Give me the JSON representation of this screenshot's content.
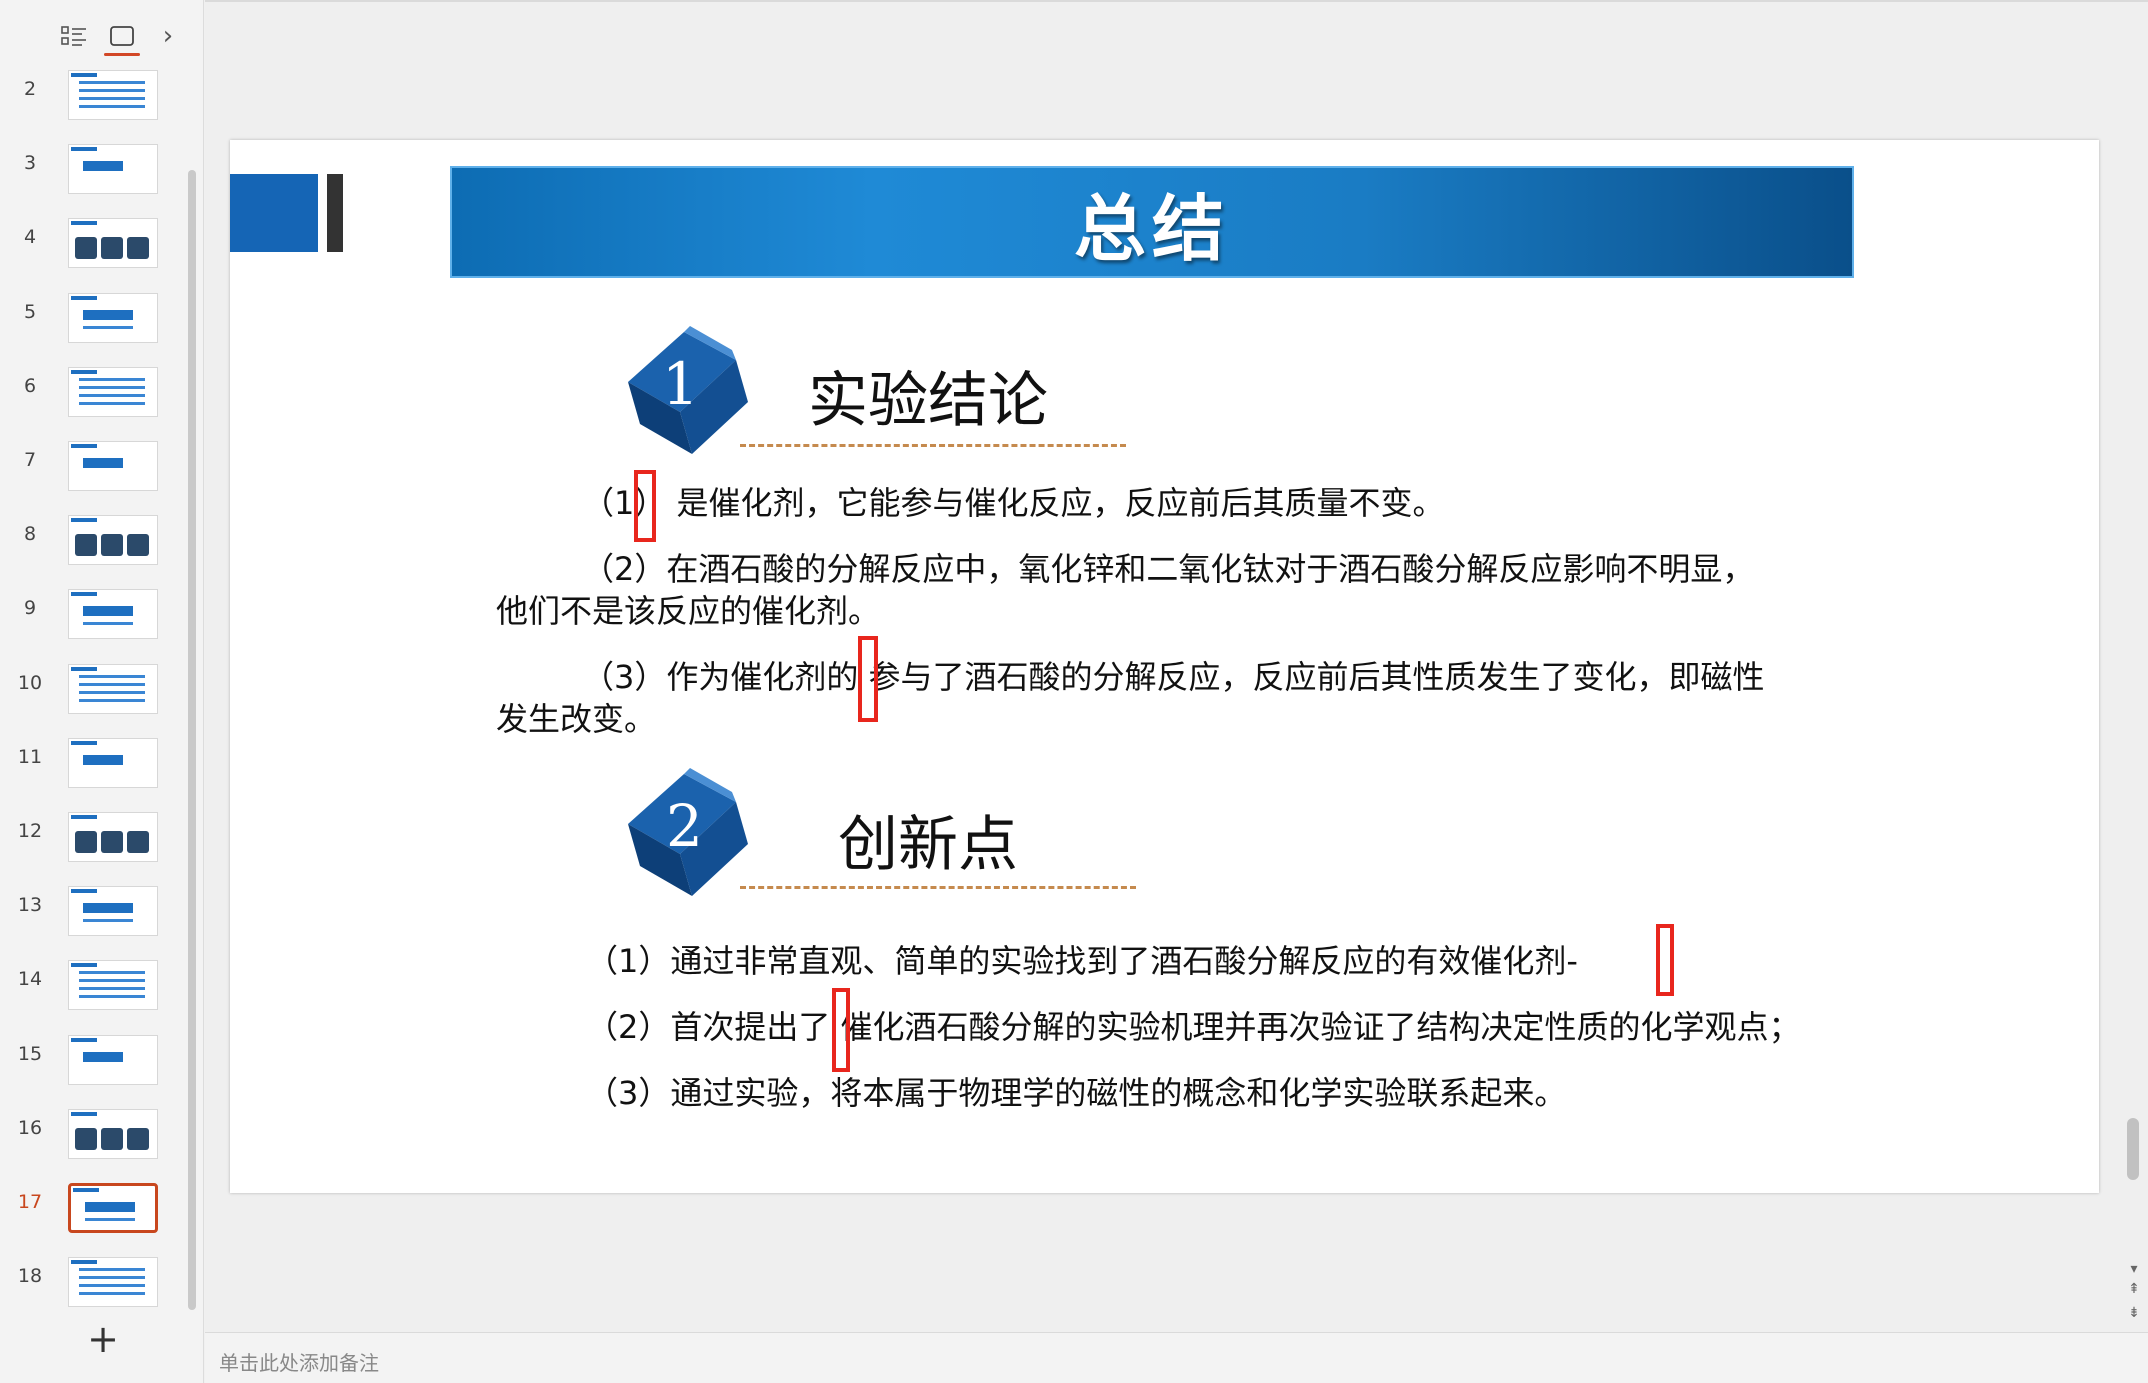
{
  "sidebar": {
    "thumbnails": [
      {
        "number": "2"
      },
      {
        "number": "3"
      },
      {
        "number": "4"
      },
      {
        "number": "5"
      },
      {
        "number": "6"
      },
      {
        "number": "7"
      },
      {
        "number": "8"
      },
      {
        "number": "9"
      },
      {
        "number": "10"
      },
      {
        "number": "11"
      },
      {
        "number": "12"
      },
      {
        "number": "13"
      },
      {
        "number": "14"
      },
      {
        "number": "15"
      },
      {
        "number": "16"
      },
      {
        "number": "17"
      },
      {
        "number": "18"
      }
    ],
    "active_slide": "17",
    "add_label": "+",
    "next_glyph": "›"
  },
  "slide": {
    "title": "总结",
    "section1": {
      "number": "1",
      "heading": "实验结论",
      "items": [
        {
          "line1": "（1） 是催化剂，它能参与催化反应，反应前后其质量不变。"
        },
        {
          "line1": "（2）在酒石酸的分解反应中，氧化锌和二氧化钛对于酒石酸分解反应影响不明显，",
          "line2": "他们不是该反应的催化剂。"
        },
        {
          "line1": "（3）作为催化剂的 参与了酒石酸的分解反应，反应前后其性质发生了变化，即磁性",
          "line2": "发生改变。"
        }
      ]
    },
    "section2": {
      "number": "2",
      "heading": "创新点",
      "items": [
        "（1）通过非常直观、简单的实验找到了酒石酸分解反应的有效催化剂-",
        "（2）首次提出了 催化酒石酸分解的实验机理并再次验证了结构决定性质的化学观点；",
        "（3）通过实验，将本属于物理学的磁性的概念和化学实验联系起来。"
      ]
    }
  },
  "notes": {
    "placeholder": "单击此处添加备注"
  },
  "colors": {
    "accent": "#d24726",
    "banner": "#1a7cc4",
    "highlight": "#e8261d",
    "cube": "#1a5fa8"
  }
}
